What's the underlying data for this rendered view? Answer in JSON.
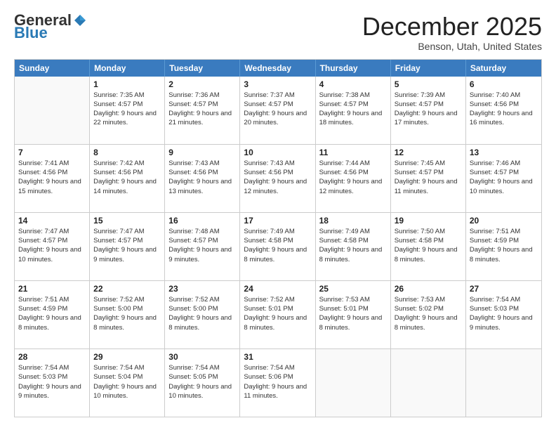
{
  "header": {
    "logo_general": "General",
    "logo_blue": "Blue",
    "month_title": "December 2025",
    "location": "Benson, Utah, United States"
  },
  "days_of_week": [
    "Sunday",
    "Monday",
    "Tuesday",
    "Wednesday",
    "Thursday",
    "Friday",
    "Saturday"
  ],
  "weeks": [
    [
      {
        "day": "",
        "empty": true
      },
      {
        "day": "1",
        "sunrise": "Sunrise: 7:35 AM",
        "sunset": "Sunset: 4:57 PM",
        "daylight": "Daylight: 9 hours and 22 minutes."
      },
      {
        "day": "2",
        "sunrise": "Sunrise: 7:36 AM",
        "sunset": "Sunset: 4:57 PM",
        "daylight": "Daylight: 9 hours and 21 minutes."
      },
      {
        "day": "3",
        "sunrise": "Sunrise: 7:37 AM",
        "sunset": "Sunset: 4:57 PM",
        "daylight": "Daylight: 9 hours and 20 minutes."
      },
      {
        "day": "4",
        "sunrise": "Sunrise: 7:38 AM",
        "sunset": "Sunset: 4:57 PM",
        "daylight": "Daylight: 9 hours and 18 minutes."
      },
      {
        "day": "5",
        "sunrise": "Sunrise: 7:39 AM",
        "sunset": "Sunset: 4:57 PM",
        "daylight": "Daylight: 9 hours and 17 minutes."
      },
      {
        "day": "6",
        "sunrise": "Sunrise: 7:40 AM",
        "sunset": "Sunset: 4:56 PM",
        "daylight": "Daylight: 9 hours and 16 minutes."
      }
    ],
    [
      {
        "day": "7",
        "sunrise": "Sunrise: 7:41 AM",
        "sunset": "Sunset: 4:56 PM",
        "daylight": "Daylight: 9 hours and 15 minutes."
      },
      {
        "day": "8",
        "sunrise": "Sunrise: 7:42 AM",
        "sunset": "Sunset: 4:56 PM",
        "daylight": "Daylight: 9 hours and 14 minutes."
      },
      {
        "day": "9",
        "sunrise": "Sunrise: 7:43 AM",
        "sunset": "Sunset: 4:56 PM",
        "daylight": "Daylight: 9 hours and 13 minutes."
      },
      {
        "day": "10",
        "sunrise": "Sunrise: 7:43 AM",
        "sunset": "Sunset: 4:56 PM",
        "daylight": "Daylight: 9 hours and 12 minutes."
      },
      {
        "day": "11",
        "sunrise": "Sunrise: 7:44 AM",
        "sunset": "Sunset: 4:56 PM",
        "daylight": "Daylight: 9 hours and 12 minutes."
      },
      {
        "day": "12",
        "sunrise": "Sunrise: 7:45 AM",
        "sunset": "Sunset: 4:57 PM",
        "daylight": "Daylight: 9 hours and 11 minutes."
      },
      {
        "day": "13",
        "sunrise": "Sunrise: 7:46 AM",
        "sunset": "Sunset: 4:57 PM",
        "daylight": "Daylight: 9 hours and 10 minutes."
      }
    ],
    [
      {
        "day": "14",
        "sunrise": "Sunrise: 7:47 AM",
        "sunset": "Sunset: 4:57 PM",
        "daylight": "Daylight: 9 hours and 10 minutes."
      },
      {
        "day": "15",
        "sunrise": "Sunrise: 7:47 AM",
        "sunset": "Sunset: 4:57 PM",
        "daylight": "Daylight: 9 hours and 9 minutes."
      },
      {
        "day": "16",
        "sunrise": "Sunrise: 7:48 AM",
        "sunset": "Sunset: 4:57 PM",
        "daylight": "Daylight: 9 hours and 9 minutes."
      },
      {
        "day": "17",
        "sunrise": "Sunrise: 7:49 AM",
        "sunset": "Sunset: 4:58 PM",
        "daylight": "Daylight: 9 hours and 8 minutes."
      },
      {
        "day": "18",
        "sunrise": "Sunrise: 7:49 AM",
        "sunset": "Sunset: 4:58 PM",
        "daylight": "Daylight: 9 hours and 8 minutes."
      },
      {
        "day": "19",
        "sunrise": "Sunrise: 7:50 AM",
        "sunset": "Sunset: 4:58 PM",
        "daylight": "Daylight: 9 hours and 8 minutes."
      },
      {
        "day": "20",
        "sunrise": "Sunrise: 7:51 AM",
        "sunset": "Sunset: 4:59 PM",
        "daylight": "Daylight: 9 hours and 8 minutes."
      }
    ],
    [
      {
        "day": "21",
        "sunrise": "Sunrise: 7:51 AM",
        "sunset": "Sunset: 4:59 PM",
        "daylight": "Daylight: 9 hours and 8 minutes."
      },
      {
        "day": "22",
        "sunrise": "Sunrise: 7:52 AM",
        "sunset": "Sunset: 5:00 PM",
        "daylight": "Daylight: 9 hours and 8 minutes."
      },
      {
        "day": "23",
        "sunrise": "Sunrise: 7:52 AM",
        "sunset": "Sunset: 5:00 PM",
        "daylight": "Daylight: 9 hours and 8 minutes."
      },
      {
        "day": "24",
        "sunrise": "Sunrise: 7:52 AM",
        "sunset": "Sunset: 5:01 PM",
        "daylight": "Daylight: 9 hours and 8 minutes."
      },
      {
        "day": "25",
        "sunrise": "Sunrise: 7:53 AM",
        "sunset": "Sunset: 5:01 PM",
        "daylight": "Daylight: 9 hours and 8 minutes."
      },
      {
        "day": "26",
        "sunrise": "Sunrise: 7:53 AM",
        "sunset": "Sunset: 5:02 PM",
        "daylight": "Daylight: 9 hours and 8 minutes."
      },
      {
        "day": "27",
        "sunrise": "Sunrise: 7:54 AM",
        "sunset": "Sunset: 5:03 PM",
        "daylight": "Daylight: 9 hours and 9 minutes."
      }
    ],
    [
      {
        "day": "28",
        "sunrise": "Sunrise: 7:54 AM",
        "sunset": "Sunset: 5:03 PM",
        "daylight": "Daylight: 9 hours and 9 minutes."
      },
      {
        "day": "29",
        "sunrise": "Sunrise: 7:54 AM",
        "sunset": "Sunset: 5:04 PM",
        "daylight": "Daylight: 9 hours and 10 minutes."
      },
      {
        "day": "30",
        "sunrise": "Sunrise: 7:54 AM",
        "sunset": "Sunset: 5:05 PM",
        "daylight": "Daylight: 9 hours and 10 minutes."
      },
      {
        "day": "31",
        "sunrise": "Sunrise: 7:54 AM",
        "sunset": "Sunset: 5:06 PM",
        "daylight": "Daylight: 9 hours and 11 minutes."
      },
      {
        "day": "",
        "empty": true
      },
      {
        "day": "",
        "empty": true
      },
      {
        "day": "",
        "empty": true
      }
    ]
  ]
}
